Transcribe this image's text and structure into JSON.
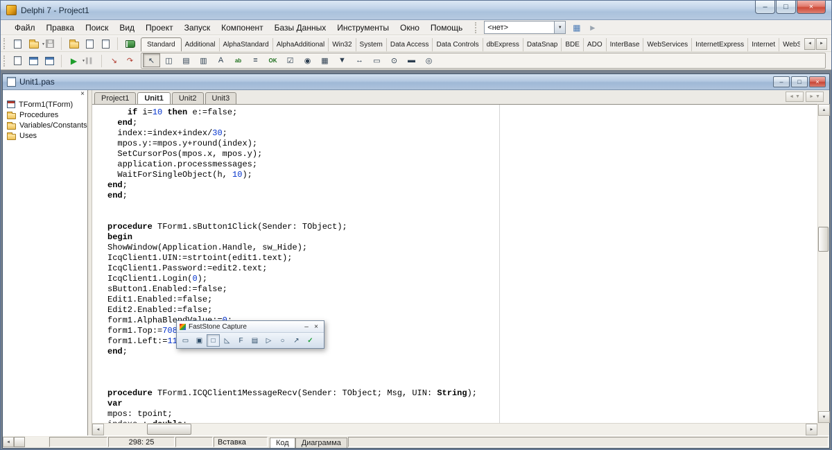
{
  "icons": {
    "up": "▲",
    "down": "▼",
    "left": "◄",
    "right": "►",
    "dropdown": "▼",
    "close": "×"
  },
  "titlebar": {
    "title": "Delphi 7 - Project1"
  },
  "window_buttons": [
    {
      "name": "minimize-button",
      "glyph": "–"
    },
    {
      "name": "maximize-button",
      "glyph": "□"
    },
    {
      "name": "close-button",
      "glyph": "×",
      "close": true
    }
  ],
  "menubar": {
    "items": [
      {
        "name": "file",
        "label": "Файл"
      },
      {
        "name": "edit",
        "label": "Правка"
      },
      {
        "name": "search",
        "label": "Поиск"
      },
      {
        "name": "view",
        "label": "Вид"
      },
      {
        "name": "project",
        "label": "Проект"
      },
      {
        "name": "run",
        "label": "Запуск"
      },
      {
        "name": "component",
        "label": "Компонент"
      },
      {
        "name": "database",
        "label": "Базы Данных"
      },
      {
        "name": "tools",
        "label": "Инструменты"
      },
      {
        "name": "window",
        "label": "Окно"
      },
      {
        "name": "help",
        "label": "Помощь"
      }
    ],
    "desktop_combo": "<нет>",
    "desktop_buttons": [
      {
        "name": "save-desktop-icon",
        "glyph": "▦",
        "color": "#4a7ab5"
      },
      {
        "name": "set-debug-desktop-icon",
        "glyph": "►",
        "color": "#9aa4b0"
      }
    ]
  },
  "toolbars": {
    "standard": [
      {
        "kind": "shape",
        "shape": "page",
        "name": "new-items-button"
      },
      {
        "kind": "shape",
        "shape": "folder",
        "name": "open-file-button",
        "dropdown": true
      },
      {
        "kind": "shape",
        "shape": "disk",
        "name": "save-file-button",
        "disabled": true
      },
      {
        "kind": "sep"
      },
      {
        "kind": "shape",
        "shape": "folder",
        "name": "open-project-button"
      },
      {
        "kind": "shape",
        "shape": "page",
        "name": "add-file-to-project-button"
      },
      {
        "kind": "shape",
        "shape": "page",
        "name": "remove-file-from-project-button"
      },
      {
        "kind": "sep"
      },
      {
        "kind": "shape",
        "shape": "book",
        "name": "help-contents-button"
      }
    ],
    "debug": [
      {
        "kind": "shape",
        "shape": "page",
        "name": "view-units-button"
      },
      {
        "kind": "shape",
        "shape": "form",
        "name": "view-forms-button"
      },
      {
        "kind": "shape",
        "shape": "form",
        "name": "toggle-form-unit-button"
      },
      {
        "kind": "sep"
      },
      {
        "kind": "glyph",
        "glyph": "▶",
        "color": "#1f9e2c",
        "size": 12,
        "name": "run-button",
        "dropdown": true
      },
      {
        "kind": "glyph",
        "glyph": "▌▌",
        "color": "#4a6fae",
        "size": 8,
        "name": "pause-button",
        "disabled": true
      },
      {
        "kind": "sep"
      },
      {
        "kind": "glyph",
        "glyph": "↘",
        "color": "#b03a2e",
        "size": 11,
        "name": "trace-into-button"
      },
      {
        "kind": "glyph",
        "glyph": "↷",
        "color": "#b03a2e",
        "size": 11,
        "name": "step-over-button"
      }
    ]
  },
  "palette": {
    "active": "Standard",
    "tabs": [
      "Standard",
      "Additional",
      "AlphaStandard",
      "AlphaAdditional",
      "Win32",
      "System",
      "Data Access",
      "Data Controls",
      "dbExpress",
      "DataSnap",
      "BDE",
      "ADO",
      "InterBase",
      "WebServices",
      "InternetExpress",
      "Internet",
      "WebSnap"
    ],
    "components": [
      {
        "name": "pointer-tool",
        "glyph": "↖",
        "pressed": true
      },
      {
        "name": "frames-component",
        "glyph": "◫"
      },
      {
        "name": "mainmenu-component",
        "glyph": "▤"
      },
      {
        "name": "popupmenu-component",
        "glyph": "▥"
      },
      {
        "name": "label-component",
        "glyph": "A"
      },
      {
        "name": "edit-component",
        "glyph": "ab"
      },
      {
        "name": "memo-component",
        "glyph": "≡"
      },
      {
        "name": "button-component",
        "glyph": "OK"
      },
      {
        "name": "checkbox-component",
        "glyph": "☑"
      },
      {
        "name": "radiobutton-component",
        "glyph": "◉"
      },
      {
        "name": "listbox-component",
        "glyph": "▦"
      },
      {
        "name": "combobox-component",
        "glyph": "▼"
      },
      {
        "name": "scrollbar-component",
        "glyph": "↔"
      },
      {
        "name": "groupbox-component",
        "glyph": "▭"
      },
      {
        "name": "radiogroup-component",
        "glyph": "⊙"
      },
      {
        "name": "panel-component",
        "glyph": "▬"
      },
      {
        "name": "actionlist-component",
        "glyph": "◎"
      }
    ]
  },
  "editor": {
    "title": "Unit1.pas",
    "window_buttons": [
      {
        "name": "editor-minimize-button",
        "glyph": "–"
      },
      {
        "name": "editor-maximize-button",
        "glyph": "□"
      },
      {
        "name": "editor-close-button",
        "glyph": "×",
        "close": true
      }
    ],
    "tabs": [
      {
        "name": "editor-tab-project1",
        "label": "Project1"
      },
      {
        "name": "editor-tab-unit1",
        "label": "Unit1",
        "active": true
      },
      {
        "name": "editor-tab-unit2",
        "label": "Unit2"
      },
      {
        "name": "editor-tab-unit3",
        "label": "Unit3"
      }
    ],
    "nav_buttons": [
      {
        "name": "browse-back-button",
        "glyph": "◄"
      },
      {
        "name": "browse-forward-button",
        "glyph": "►"
      }
    ],
    "explorer": {
      "items": [
        {
          "icon": "form",
          "label": "TForm1(TForm)"
        },
        {
          "icon": "folder",
          "label": "Procedures"
        },
        {
          "icon": "folder",
          "label": "Variables/Constants"
        },
        {
          "icon": "folder",
          "label": "Uses"
        }
      ]
    },
    "code": {
      "number_color": "#0030cc",
      "keywords": [
        "if",
        "then",
        "end",
        "procedure",
        "begin",
        "var",
        "string",
        "double"
      ],
      "lines": [
        "    if i=10 then e:=false;",
        "  end;",
        "  index:=index+index/30;",
        "  mpos.y:=mpos.y+round(index);",
        "  SetCursorPos(mpos.x, mpos.y);",
        "  application.processmessages;",
        "  WaitForSingleObject(h, 10);",
        "end;",
        "end;",
        "",
        "",
        "procedure TForm1.sButton1Click(Sender: TObject);",
        "begin",
        "ShowWindow(Application.Handle, sw_Hide);",
        "IcqClient1.UIN:=strtoint(edit1.text);",
        "IcqClient1.Password:=edit2.text;",
        "IcqClient1.Login(0);",
        "sButton1.Enabled:=false;",
        "Edit1.Enabled:=false;",
        "Edit2.Enabled:=false;",
        "form1.AlphaBlendValue:=0;",
        "form1.Top:=708;",
        "form1.Left:=11;",
        "end;",
        "",
        "",
        "",
        "procedure TForm1.ICQClient1MessageRecv(Sender: TObject; Msg, UIN: String);",
        "var",
        "mpos: tpoint;",
        "indexs : double;"
      ]
    }
  },
  "status": {
    "position": "298: 25",
    "mode": "Вставка",
    "tabs": [
      {
        "name": "view-tab-code",
        "label": "Код",
        "active": true
      },
      {
        "name": "view-tab-diagram",
        "label": "Диаграмма"
      }
    ]
  },
  "faststone": {
    "title": "FastStone Capture",
    "buttons": [
      {
        "name": "faststone-minimize-button",
        "glyph": "–"
      },
      {
        "name": "faststone-close-button",
        "glyph": "×"
      }
    ],
    "tools": [
      {
        "name": "capture-rectangle-icon",
        "glyph": "▭"
      },
      {
        "name": "capture-window-icon",
        "glyph": "▣"
      },
      {
        "name": "capture-region-icon",
        "glyph": "□",
        "pressed": true
      },
      {
        "name": "capture-freehand-icon",
        "glyph": "◺"
      },
      {
        "name": "capture-fullscreen-icon",
        "glyph": "F"
      },
      {
        "name": "capture-scrolling-icon",
        "glyph": "▤"
      },
      {
        "name": "open-file-icon",
        "glyph": "▷"
      },
      {
        "name": "magnifier-icon",
        "glyph": "○"
      },
      {
        "name": "color-picker-icon",
        "glyph": "↗"
      },
      {
        "name": "settings-icon",
        "glyph": "✓",
        "colorful": true
      }
    ]
  }
}
